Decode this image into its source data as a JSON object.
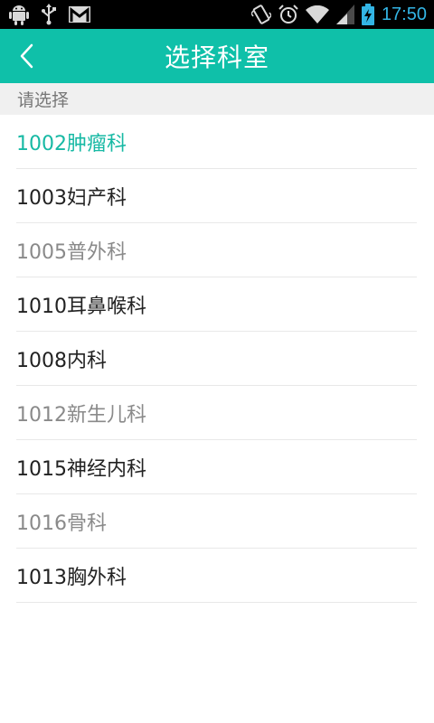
{
  "status_bar": {
    "time": "17:50",
    "colors": {
      "icon": "#d9d9d9",
      "time": "#33b5e5"
    },
    "icons": [
      "android-debug-icon",
      "usb-icon",
      "gmail-icon",
      "vibrate-icon",
      "alarm-icon",
      "wifi-icon",
      "signal-icon",
      "battery-charging-icon"
    ]
  },
  "app_bar": {
    "title": "选择科室",
    "back_icon": "chevron-left-icon",
    "color": "#0fc0a9"
  },
  "section_header": {
    "label": "请选择"
  },
  "departments": [
    {
      "label": "1002肿瘤科",
      "color": "#17b9a4",
      "state": "selected"
    },
    {
      "label": "1003妇产科",
      "color": "#222222",
      "state": "enabled"
    },
    {
      "label": "1005普外科",
      "color": "#8a8a8a",
      "state": "disabled"
    },
    {
      "label": "1010耳鼻喉科",
      "color": "#222222",
      "state": "enabled"
    },
    {
      "label": "1008内科",
      "color": "#222222",
      "state": "enabled"
    },
    {
      "label": "1012新生儿科",
      "color": "#8a8a8a",
      "state": "disabled"
    },
    {
      "label": "1015神经内科",
      "color": "#222222",
      "state": "enabled"
    },
    {
      "label": "1016骨科",
      "color": "#8a8a8a",
      "state": "disabled"
    },
    {
      "label": "1013胸外科",
      "color": "#222222",
      "state": "enabled"
    }
  ]
}
